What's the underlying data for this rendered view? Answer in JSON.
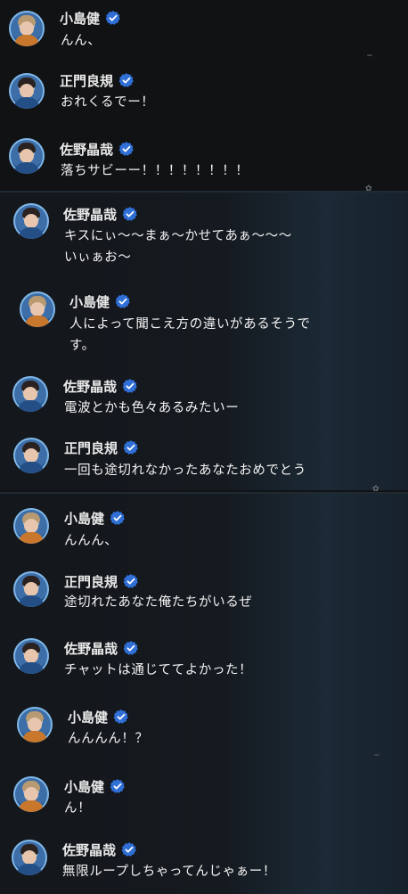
{
  "messages": [
    {
      "name": "小島健",
      "text": [
        "んん、"
      ]
    },
    {
      "name": "正門良規",
      "text": [
        "おれくるでー！"
      ]
    },
    {
      "name": "佐野晶哉",
      "text": [
        "落ちサビーー！！！！！！！！"
      ]
    },
    {
      "name": "佐野晶哉",
      "text": [
        "キスにぃ〜〜まぁ〜かせてあぁ〜〜〜",
        "いぃぁお〜"
      ]
    },
    {
      "name": "小島健",
      "text": [
        "人によって聞こえ方の違いがあるそうで",
        "す。"
      ]
    },
    {
      "name": "佐野晶哉",
      "text": [
        "電波とかも色々あるみたいー"
      ]
    },
    {
      "name": "正門良規",
      "text": [
        "一回も途切れなかったあなたおめでとう"
      ]
    },
    {
      "name": "小島健",
      "text": [
        "んんん、"
      ]
    },
    {
      "name": "正門良規",
      "text": [
        "途切れたあなた俺たちがいるぜ"
      ]
    },
    {
      "name": "佐野晶哉",
      "text": [
        "チャットは通じててよかった！"
      ]
    },
    {
      "name": "小島健",
      "text": [
        "んんんん！？"
      ]
    },
    {
      "name": "小島健",
      "text": [
        "ん！"
      ]
    },
    {
      "name": "佐野晶哉",
      "text": [
        "無限ループしちゃってんじゃぁー！"
      ]
    }
  ],
  "colors": {
    "background": "#111214",
    "verified_badge": "#2f6fd6",
    "name_text": "#eaeaea",
    "message_text": "#f4f4f4"
  },
  "icons": {
    "verified": "verified-badge-icon",
    "avatar": "member-avatar"
  }
}
